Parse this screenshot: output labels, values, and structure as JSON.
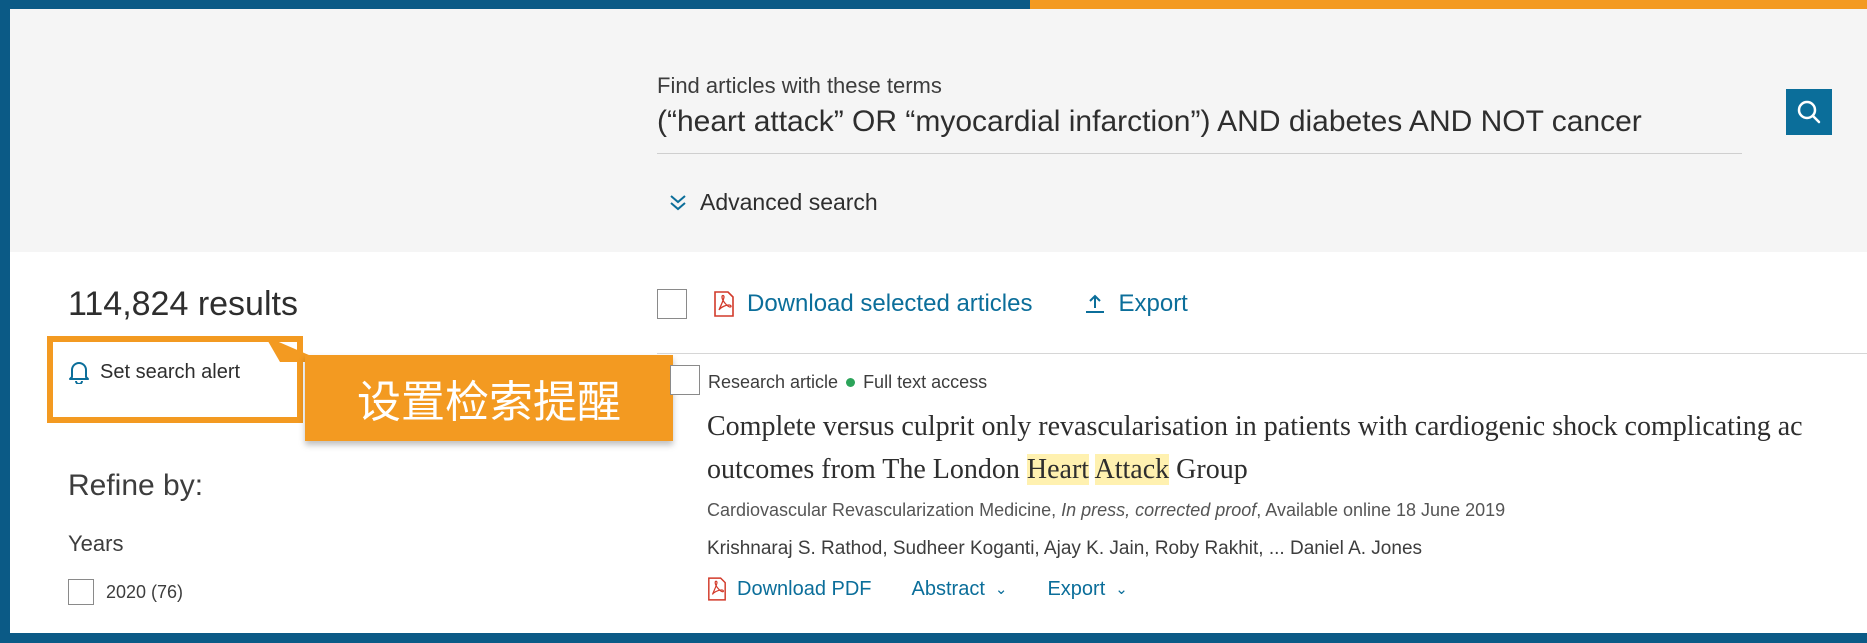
{
  "search": {
    "label": "Find articles with these terms",
    "query": "(“heart attack” OR “myocardial infarction”) AND diabetes AND NOT cancer",
    "advanced_label": "Advanced search"
  },
  "results": {
    "count_text": "114,824 results",
    "alert_label": "Set search alert",
    "callout_text": "设置检索提醒"
  },
  "toolbar": {
    "download_label": "Download selected articles",
    "export_label": "Export"
  },
  "refine": {
    "title": "Refine by:",
    "years_label": "Years",
    "year_option": "2020 (76)"
  },
  "article": {
    "type": "Research article",
    "access": "Full text access",
    "title_before": "Complete versus culprit only revascularisation in patients with cardiogenic shock complicating ac",
    "title_line2_before": "outcomes from The London ",
    "title_highlight_1": "Heart",
    "title_highlight_2": "Attack",
    "title_line2_after": " Group",
    "source_journal": "Cardiovascular Revascularization Medicine, ",
    "source_status": "In press, corrected proof",
    "source_date": ", Available online 18 June 2019",
    "authors": "Krishnaraj S. Rathod, Sudheer Koganti, Ajay K. Jain, Roby Rakhit, ... Daniel A. Jones",
    "download_pdf": "Download PDF",
    "abstract": "Abstract",
    "export": "Export"
  },
  "colors": {
    "frame": "#0b5a86",
    "accent_orange": "#f39a21",
    "link_blue": "#0b6e9a",
    "highlight": "#fff1b0",
    "access_green": "#2ca45a"
  },
  "icons": [
    "search-icon",
    "chevron-double-down-icon",
    "bell-icon",
    "pdf-icon",
    "export-icon",
    "chevron-down-icon"
  ]
}
